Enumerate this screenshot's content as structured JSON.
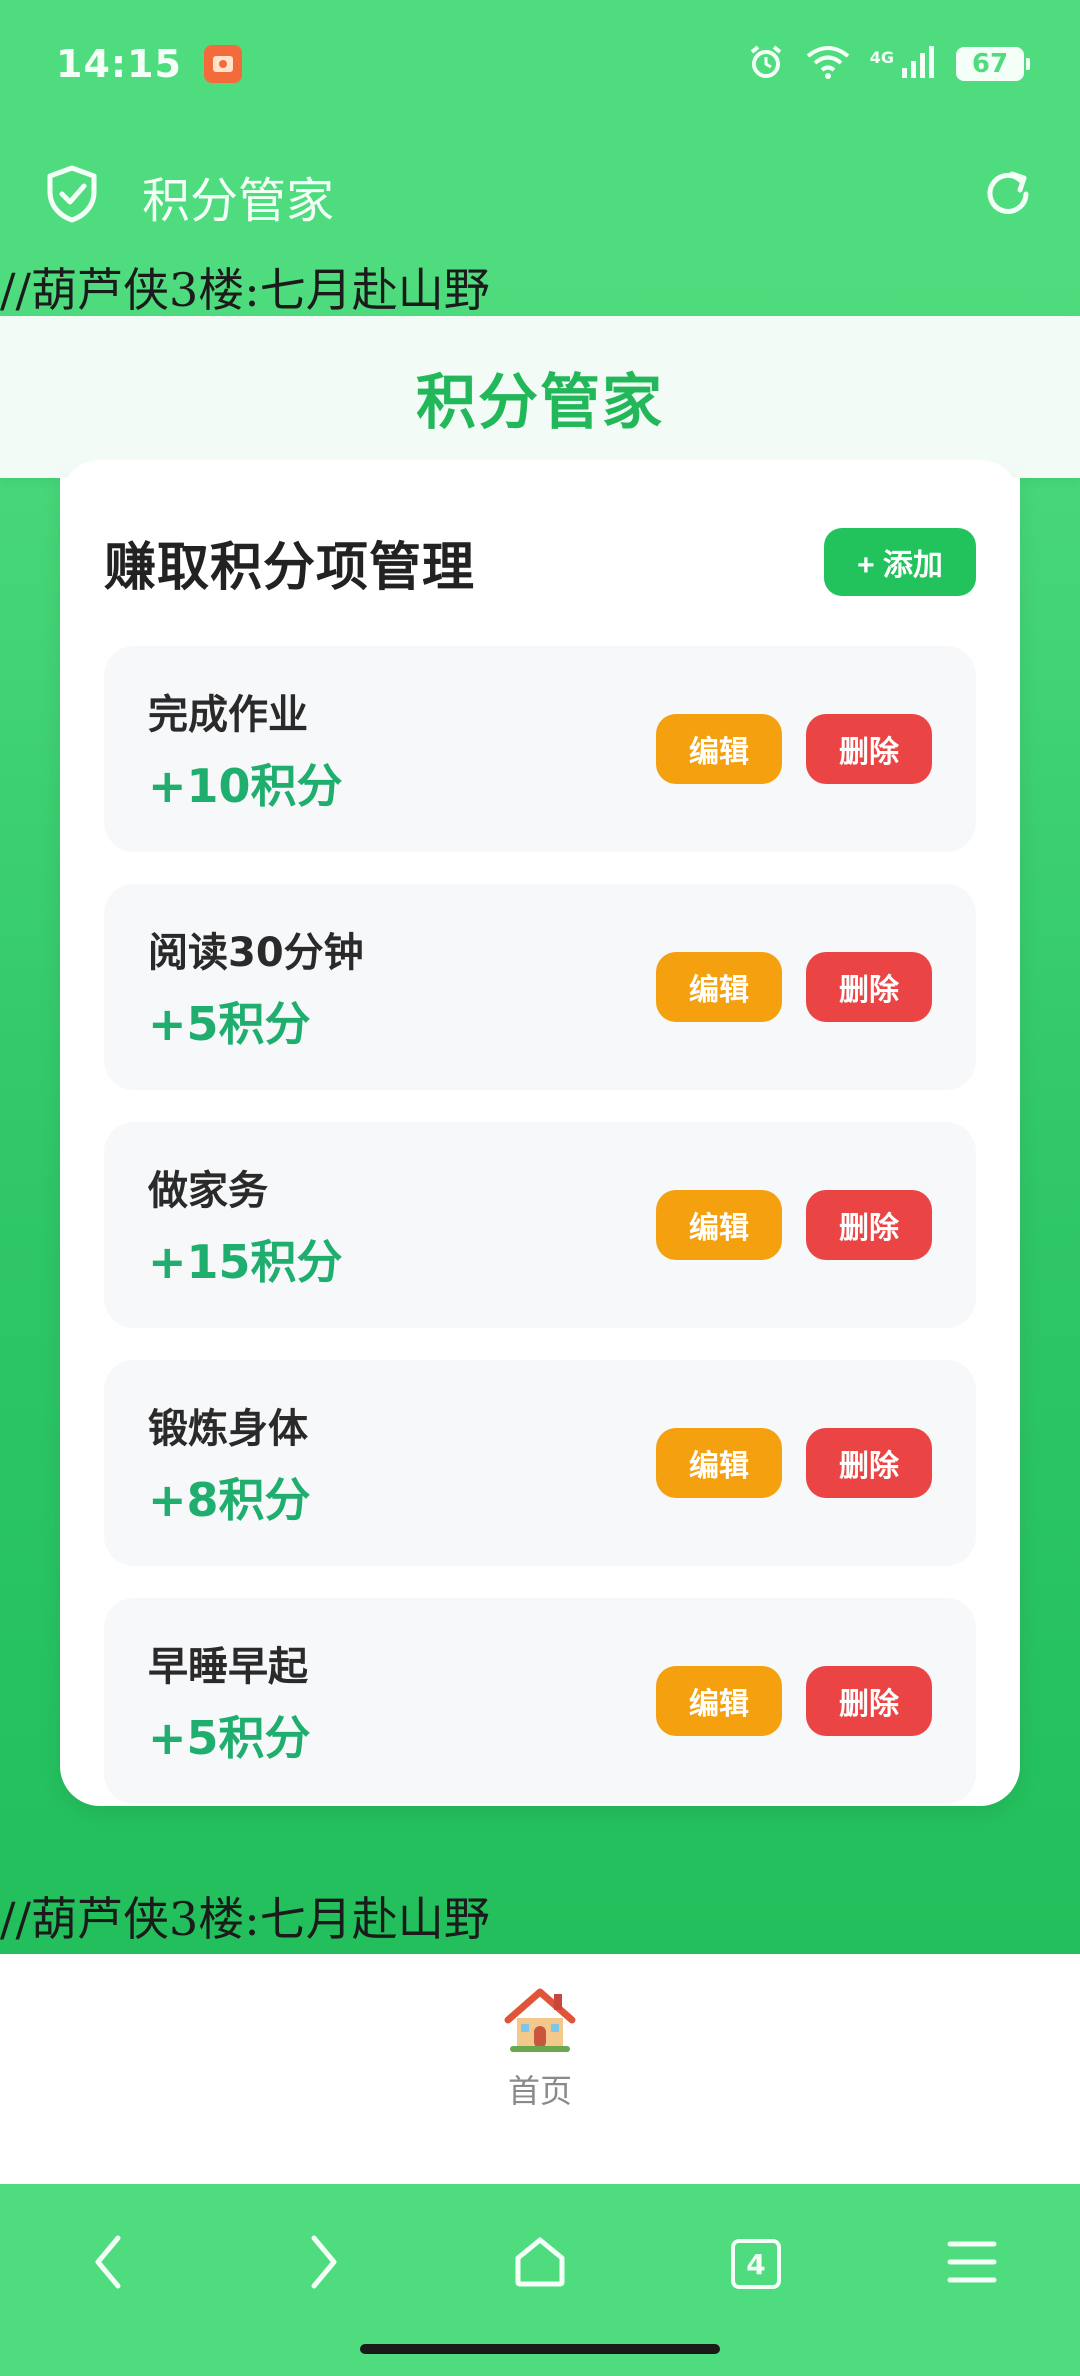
{
  "status_bar": {
    "time": "14:15",
    "network": "4G",
    "battery": "67",
    "icons": [
      "alarm-icon",
      "wifi-icon",
      "signal-icon",
      "battery-icon"
    ]
  },
  "toolbar": {
    "title": "积分管家",
    "icons": [
      "shield-check-icon",
      "refresh-icon"
    ]
  },
  "watermark": {
    "top": "//葫芦侠3楼:七月赴山野",
    "bottom": "//葫芦侠3楼:七月赴山野"
  },
  "page": {
    "header_title": "积分管家",
    "section_title": "赚取积分项管理",
    "add_label": "+ 添加",
    "edit_label": "编辑",
    "delete_label": "删除"
  },
  "items": [
    {
      "name": "完成作业",
      "points": "+10积分"
    },
    {
      "name": "阅读30分钟",
      "points": "+5积分"
    },
    {
      "name": "做家务",
      "points": "+15积分"
    },
    {
      "name": "锻炼身体",
      "points": "+8积分"
    },
    {
      "name": "早睡早起",
      "points": "+5积分"
    }
  ],
  "tabbar": {
    "home_label": "首页",
    "home_icon": "house-icon"
  },
  "browser_nav": {
    "tab_count": "4",
    "icons": [
      "back-icon",
      "forward-icon",
      "home-icon",
      "tabs-icon",
      "menu-icon"
    ]
  },
  "colors": {
    "brand_green": "#4fdc7e",
    "accent_green": "#22c25c",
    "points_green": "#1fae6d",
    "edit_orange": "#f5a10f",
    "delete_red": "#ea4444"
  }
}
